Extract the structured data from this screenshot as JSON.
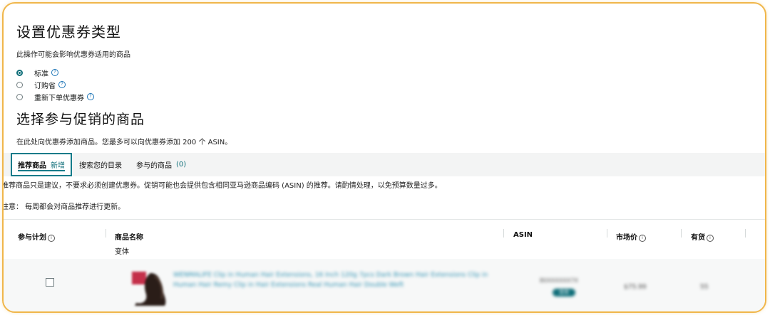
{
  "coupon_type": {
    "title": "设置优惠券类型",
    "description": "此操作可能会影响优惠券适用的商品",
    "options": [
      {
        "label": "标准",
        "selected": true
      },
      {
        "label": "订购省",
        "selected": false
      },
      {
        "label": "重新下单优惠券",
        "selected": false
      }
    ]
  },
  "product_selection": {
    "title": "选择参与促销的商品",
    "description": "在此处向优惠券添加商品。您最多可以向优惠券添加 200 个 ASIN。",
    "tabs": [
      {
        "label": "推荐商品",
        "badge": "新增",
        "active": true
      },
      {
        "label": "搜索您的目录",
        "active": false
      },
      {
        "label": "参与的商品",
        "count": "(0)",
        "active": false
      }
    ],
    "note1": "推荐商品只是建议，不要求必须创建优惠券。促销可能也会提供包含相同亚马逊商品编码 (ASIN) 的推荐。请酌情处理，以免预算数量过多。",
    "note2": "注意：  每周都会对商品推荐进行更新。"
  },
  "table": {
    "headers": {
      "participate": "参与计划",
      "product_name": "商品名称",
      "variant": "变体",
      "asin": "ASIN",
      "market_price": "市场价",
      "in_stock": "有货"
    },
    "rows": [
      {
        "product_name": "WENMALIFE Clip in Human Hair Extensions, 16 Inch 120g 7pcs Dark Brown Hair Extensions Clip in Human Hair Remy Clip in Hair Extensions Real Human Hair Double Weft",
        "asin": "B0XXXXXX7X",
        "asin_badge": "变体",
        "market_price": "$75.99",
        "in_stock": "55",
        "checked": false
      }
    ]
  },
  "colors": {
    "accent": "#0f6e79",
    "frame": "#f0b64a",
    "link": "#2a8fb0"
  }
}
